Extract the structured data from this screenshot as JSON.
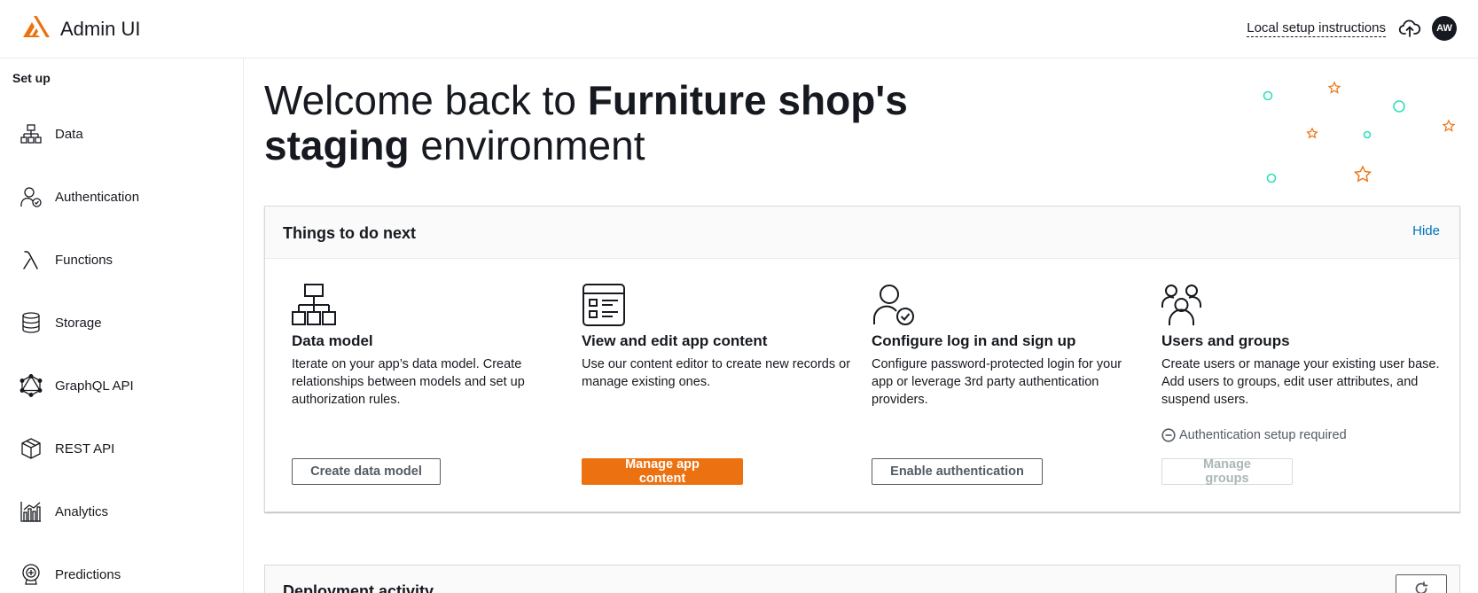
{
  "app": {
    "title": "Admin UI"
  },
  "header": {
    "setup_link": "Local setup instructions",
    "avatar_initials": "AW"
  },
  "sidebar": {
    "heading": "Set up",
    "items": [
      {
        "label": "Data",
        "icon": "data-model-icon"
      },
      {
        "label": "Authentication",
        "icon": "user-check-icon"
      },
      {
        "label": "Functions",
        "icon": "lambda-icon"
      },
      {
        "label": "Storage",
        "icon": "database-icon"
      },
      {
        "label": "GraphQL API",
        "icon": "graphql-icon"
      },
      {
        "label": "REST API",
        "icon": "cube-icon"
      },
      {
        "label": "Analytics",
        "icon": "bar-chart-icon"
      },
      {
        "label": "Predictions",
        "icon": "brain-icon"
      }
    ]
  },
  "main": {
    "welcome": {
      "prefix": "Welcome back to ",
      "app_name": "Furniture shop's",
      "env_name": "staging",
      "suffix": " environment"
    },
    "todo": {
      "title": "Things to do next",
      "hide_label": "Hide",
      "cards": [
        {
          "title": "Data model",
          "description": "Iterate on your app’s data model. Create relationships between models and set up authorization rules.",
          "button": "Create data model"
        },
        {
          "title": "View and edit app content",
          "description": "Use our content editor to create new records or manage existing ones.",
          "button": "Manage app content"
        },
        {
          "title": "Configure log in and sign up",
          "description": "Configure password-protected login for your app or leverage 3rd party authentication providers.",
          "button": "Enable authentication"
        },
        {
          "title": "Users and groups",
          "description": "Create users or manage your existing user base. Add users to groups, edit user attributes, and suspend users.",
          "note": "Authentication setup required",
          "button": "Manage groups"
        }
      ]
    },
    "deployment": {
      "title": "Deployment activity"
    }
  },
  "colors": {
    "accent": "#ec7211",
    "link": "#0073bb",
    "text": "#16191f",
    "teal": "#2ee0b8"
  }
}
